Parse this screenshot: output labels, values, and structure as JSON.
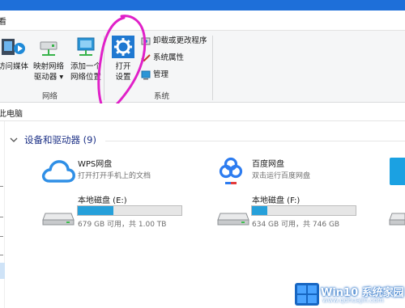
{
  "ribbon": {
    "tab_partial": "看",
    "buttons": {
      "access_media": "访问媒体",
      "map_drive_1": "映射网络",
      "map_drive_2": "驱动器 ▾",
      "add_location_1": "添加一个",
      "add_location_2": "网络位置",
      "open_settings_1": "打开",
      "open_settings_2": "设置",
      "uninstall": "卸载或更改程序",
      "properties": "系统属性",
      "manage": "管理"
    },
    "groups": {
      "network": "网络",
      "system": "系统"
    }
  },
  "address": {
    "path": "此电脑"
  },
  "section": {
    "title": "设备和驱动器 (9)"
  },
  "items": [
    {
      "title": "WPS网盘",
      "subtitle": "打开打开手机上的文档",
      "icon": "cloud-icon"
    },
    {
      "title": "百度网盘",
      "subtitle": "双击运行百度网盘",
      "icon": "baidu-netdisk-icon"
    }
  ],
  "drives": [
    {
      "label": "本地磁盘 (E:)",
      "free_text": "679 GB 可用，共 1.00 TB",
      "used_fraction": 0.34
    },
    {
      "label": "本地磁盘 (F:)",
      "free_text": "634 GB 可用，共 746 GB",
      "used_fraction": 0.15
    }
  ],
  "watermark": {
    "brand": "Win10 系统家园",
    "url": "www.qdhuajin.com"
  },
  "colors": {
    "accent": "#1e6fd9",
    "bar_fill": "#26a0da",
    "annotation": "#e020c8"
  }
}
